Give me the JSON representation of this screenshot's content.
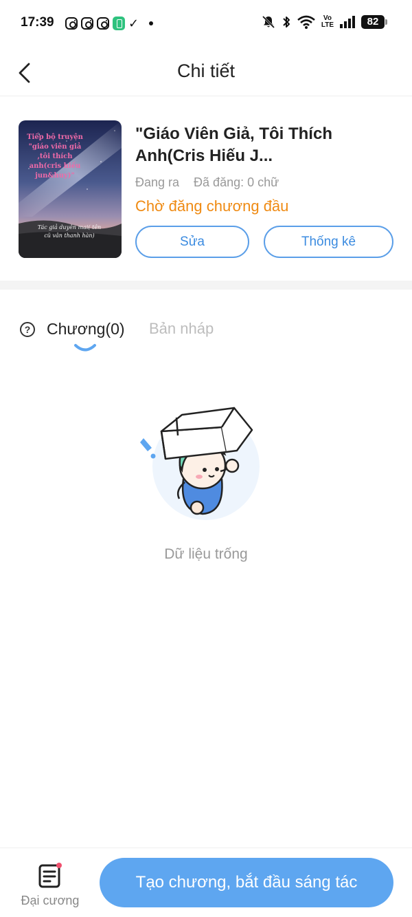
{
  "status_bar": {
    "time": "17:39",
    "network": "Vo\nLTE",
    "battery": "82",
    "icons": [
      "instagram-icon",
      "instagram-icon",
      "instagram-icon",
      "green-app-icon",
      "check-icon",
      "dot-icon",
      "mute-bell-icon",
      "bluetooth-icon",
      "wifi-icon",
      "volte-icon",
      "signal-icon",
      "battery-icon"
    ]
  },
  "header": {
    "title": "Chi tiết",
    "back_icon": "chevron-left-icon"
  },
  "book": {
    "title": "\"Giáo Viên Giả, Tôi Thích Anh(Cris Hiếu J...",
    "status": "Đang ra",
    "word_count": "Đã đăng: 0 chữ",
    "publish_status": "Chờ đăng chương đầu",
    "cover": {
      "title": "Tiếp bộ truyện \"giáo viên giả ,tôi thích anh(cris hiếu jun&huy)\"",
      "author": "Tác giả duyên mai( tên cũ vân thanh hàn)"
    },
    "edit_label": "Sửa",
    "stats_label": "Thống kê"
  },
  "tabs": {
    "chapters_label": "Chương(0)",
    "drafts_label": "Bản nháp",
    "active": "chapters"
  },
  "empty_state": {
    "text": "Dữ liệu trống"
  },
  "bottom_bar": {
    "outline_label": "Đại cương",
    "create_label": "Tạo chương, bắt đầu sáng tác"
  },
  "colors": {
    "accent_blue": "#5ea6f0",
    "button_outline": "#5a9ee8",
    "status_orange": "#ef8a12",
    "muted_text": "#999999",
    "notification_dot": "#f0506e"
  }
}
